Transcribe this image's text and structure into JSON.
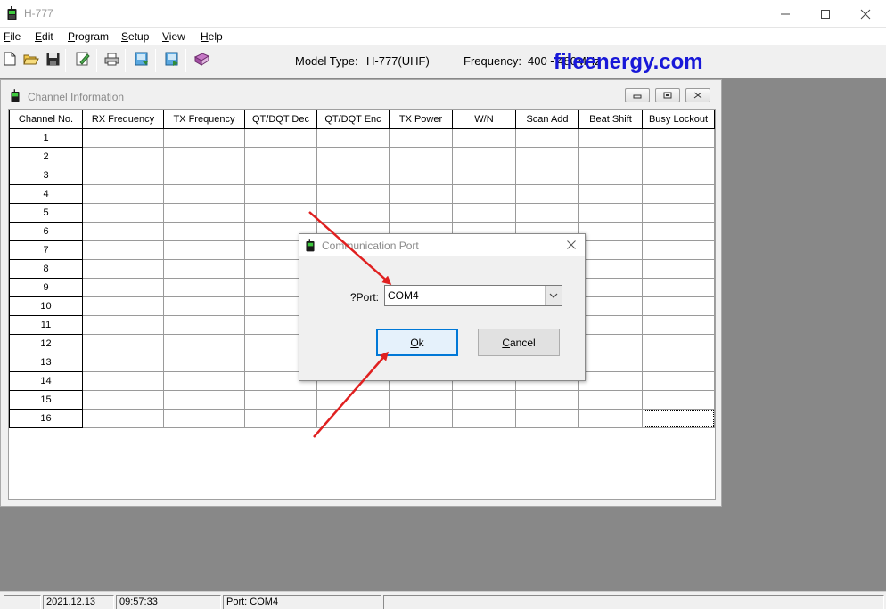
{
  "app": {
    "title": "H-777"
  },
  "menu": [
    {
      "label": "File",
      "accel": "F",
      "rest": "ile"
    },
    {
      "label": "Edit",
      "accel": "E",
      "rest": "dit"
    },
    {
      "label": "Program",
      "accel": "P",
      "rest": "rogram"
    },
    {
      "label": "Setup",
      "accel": "S",
      "rest": "etup"
    },
    {
      "label": "View",
      "accel": "V",
      "rest": "iew"
    },
    {
      "label": "Help",
      "accel": "H",
      "rest": "elp"
    }
  ],
  "toolbar": {
    "icons": [
      "new-file-icon",
      "open-folder-icon",
      "save-icon",
      "edit-icon",
      "print-icon",
      "read-from-radio-icon",
      "write-to-radio-icon",
      "book-icon"
    ],
    "model_label": "Model Type:",
    "model_value": "H-777(UHF)",
    "freq_label": "Frequency:",
    "freq_value": "400 - 480MHz"
  },
  "watermark": "fileenergy.com",
  "channel_window": {
    "title": "Channel Information",
    "columns": [
      "Channel No.",
      "RX Frequency",
      "TX Frequency",
      "QT/DQT Dec",
      "QT/DQT Enc",
      "TX Power",
      "W/N",
      "Scan Add",
      "Beat Shift",
      "Busy Lockout"
    ],
    "rows": [
      "1",
      "2",
      "3",
      "4",
      "5",
      "6",
      "7",
      "8",
      "9",
      "10",
      "11",
      "12",
      "13",
      "14",
      "15",
      "16"
    ]
  },
  "dialog": {
    "title": "Communication Port",
    "port_label": "?Port:",
    "port_value": "COM4",
    "ok_label": "Ok",
    "ok_accel": "O",
    "ok_rest": "k",
    "cancel_label": "Cancel",
    "cancel_accel": "C",
    "cancel_rest": "ancel"
  },
  "status": {
    "date": "2021.12.13",
    "time": "09:57:33",
    "port": "Port: COM4"
  },
  "colors": {
    "annotation_arrow": "#e02020",
    "watermark": "#1818d8",
    "mdi_background": "#888888",
    "dialog_default_border": "#0078d7"
  }
}
